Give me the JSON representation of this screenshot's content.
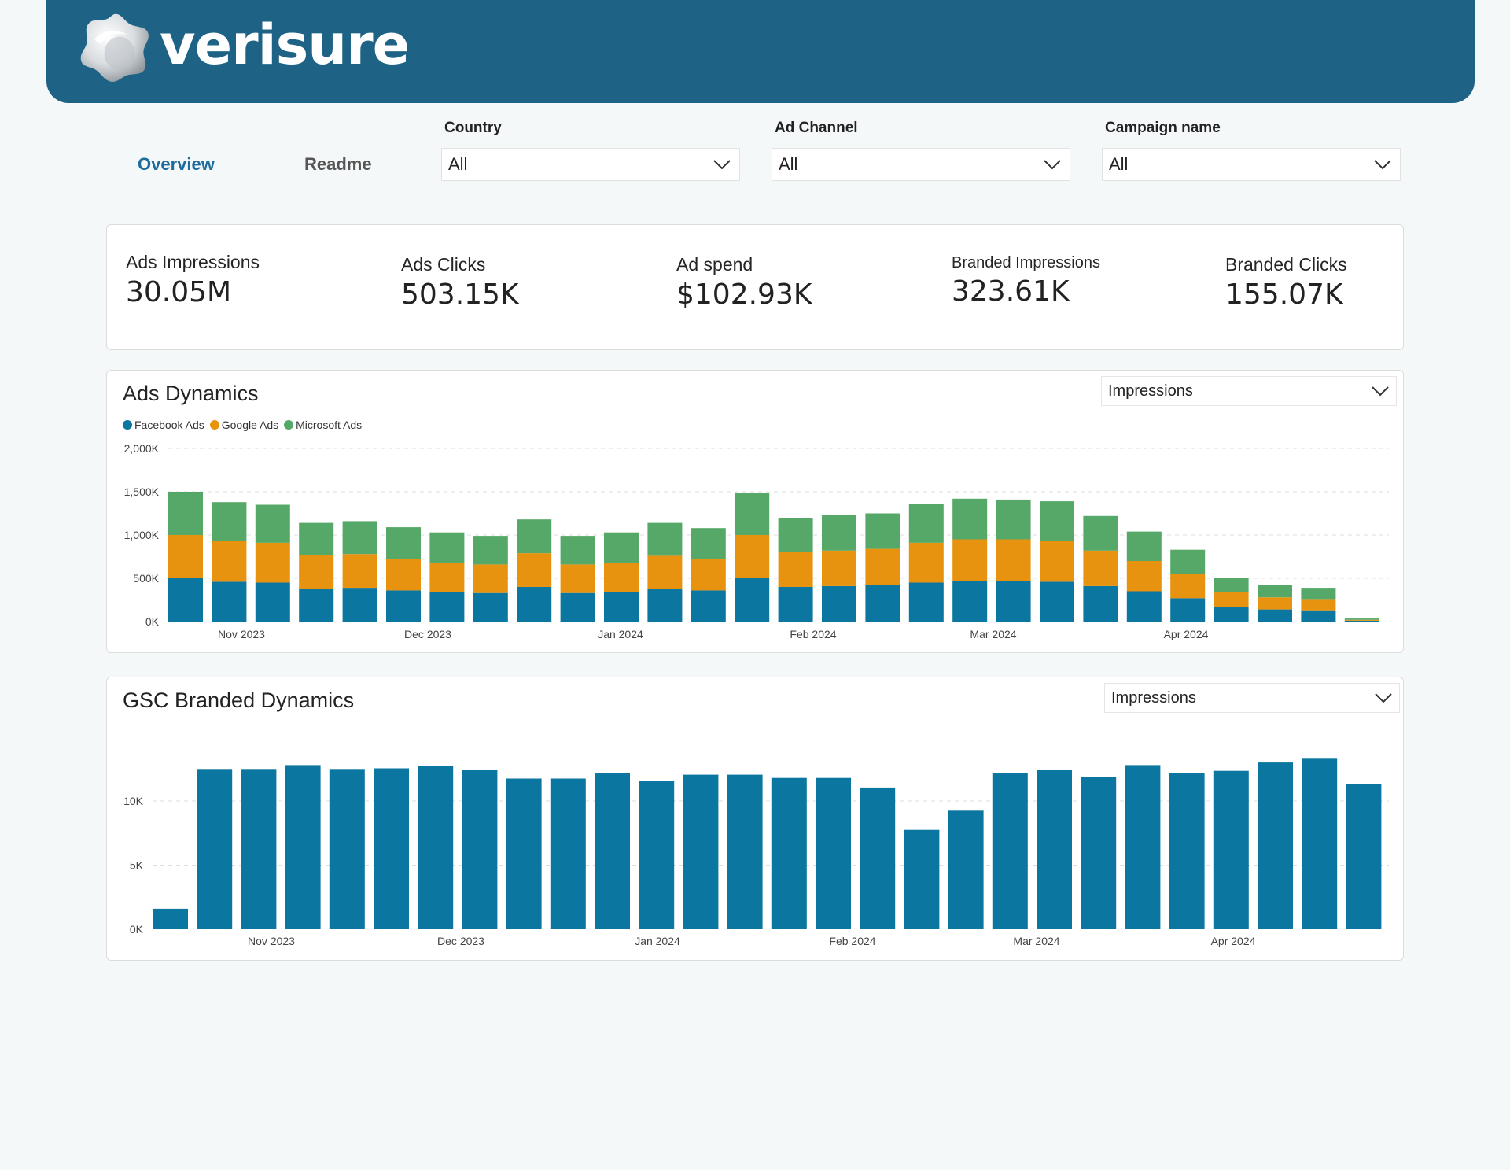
{
  "brand": {
    "name": "verisure",
    "logo_icon": "verisure-star-logo-icon"
  },
  "nav": {
    "tabs": [
      {
        "label": "Overview",
        "active": true
      },
      {
        "label": "Readme",
        "active": false
      }
    ]
  },
  "filters": [
    {
      "label": "Country",
      "value": "All"
    },
    {
      "label": "Ad Channel",
      "value": "All"
    },
    {
      "label": "Campaign name",
      "value": "All"
    }
  ],
  "kpis": [
    {
      "label": "Ads Impressions",
      "value": "30.05M"
    },
    {
      "label": "Ads Clicks",
      "value": "503.15K"
    },
    {
      "label": "Ad spend",
      "value": "$102.93K"
    },
    {
      "label": "Branded Impressions",
      "value": "323.61K"
    },
    {
      "label": "Branded Clicks",
      "value": "155.07K"
    }
  ],
  "colors": {
    "header": "#1e6385",
    "facebook": "#0b76a0",
    "google": "#e8930f",
    "microsoft": "#55a868",
    "gsc": "#0b76a0"
  },
  "ads_dynamics": {
    "title": "Ads Dynamics",
    "metric": "Impressions"
  },
  "gsc_dynamics": {
    "title": "GSC Branded Dynamics",
    "metric": "Impressions"
  },
  "chart_data": [
    {
      "type": "bar",
      "stacked": true,
      "title": "Ads Dynamics",
      "x_tick_labels": [
        "Nov 2023",
        "Dec 2023",
        "Jan 2024",
        "Feb 2024",
        "Mar 2024",
        "Apr 2024"
      ],
      "y_tick_labels": [
        "0K",
        "500K",
        "1,000K",
        "1,500K",
        "2,000K"
      ],
      "ylim": [
        0,
        2000
      ],
      "y_unit": "K",
      "legend_position": "top-left",
      "grid": true,
      "series": [
        {
          "name": "Facebook Ads",
          "color": "#0b76a0",
          "values": [
            500,
            460,
            450,
            380,
            390,
            360,
            340,
            330,
            400,
            330,
            340,
            380,
            360,
            500,
            400,
            410,
            420,
            450,
            470,
            470,
            460,
            410,
            350,
            270,
            170,
            140,
            130,
            10
          ]
        },
        {
          "name": "Google Ads",
          "color": "#e8930f",
          "values": [
            500,
            470,
            460,
            390,
            390,
            360,
            340,
            330,
            390,
            330,
            340,
            380,
            360,
            500,
            400,
            410,
            420,
            460,
            480,
            480,
            470,
            410,
            350,
            280,
            170,
            140,
            130,
            10
          ]
        },
        {
          "name": "Microsoft Ads",
          "color": "#55a868",
          "values": [
            500,
            450,
            440,
            370,
            380,
            370,
            350,
            330,
            390,
            330,
            350,
            380,
            360,
            490,
            400,
            410,
            410,
            450,
            470,
            460,
            460,
            400,
            340,
            280,
            160,
            140,
            130,
            15
          ]
        }
      ]
    },
    {
      "type": "bar",
      "title": "GSC Branded Dynamics",
      "x_tick_labels": [
        "Nov 2023",
        "Dec 2023",
        "Jan 2024",
        "Feb 2024",
        "Mar 2024",
        "Apr 2024"
      ],
      "y_tick_labels": [
        "0K",
        "5K",
        "10K"
      ],
      "ylim": [
        0,
        13500
      ],
      "grid": true,
      "series": [
        {
          "color": "#0b76a0",
          "values": [
            1600,
            12500,
            12500,
            12800,
            12500,
            12550,
            12750,
            12400,
            11750,
            11750,
            12150,
            11550,
            12050,
            12050,
            11800,
            11800,
            11050,
            7750,
            9250,
            12150,
            12450,
            11900,
            12800,
            12200,
            12350,
            13000,
            13300,
            11300
          ]
        }
      ]
    }
  ]
}
